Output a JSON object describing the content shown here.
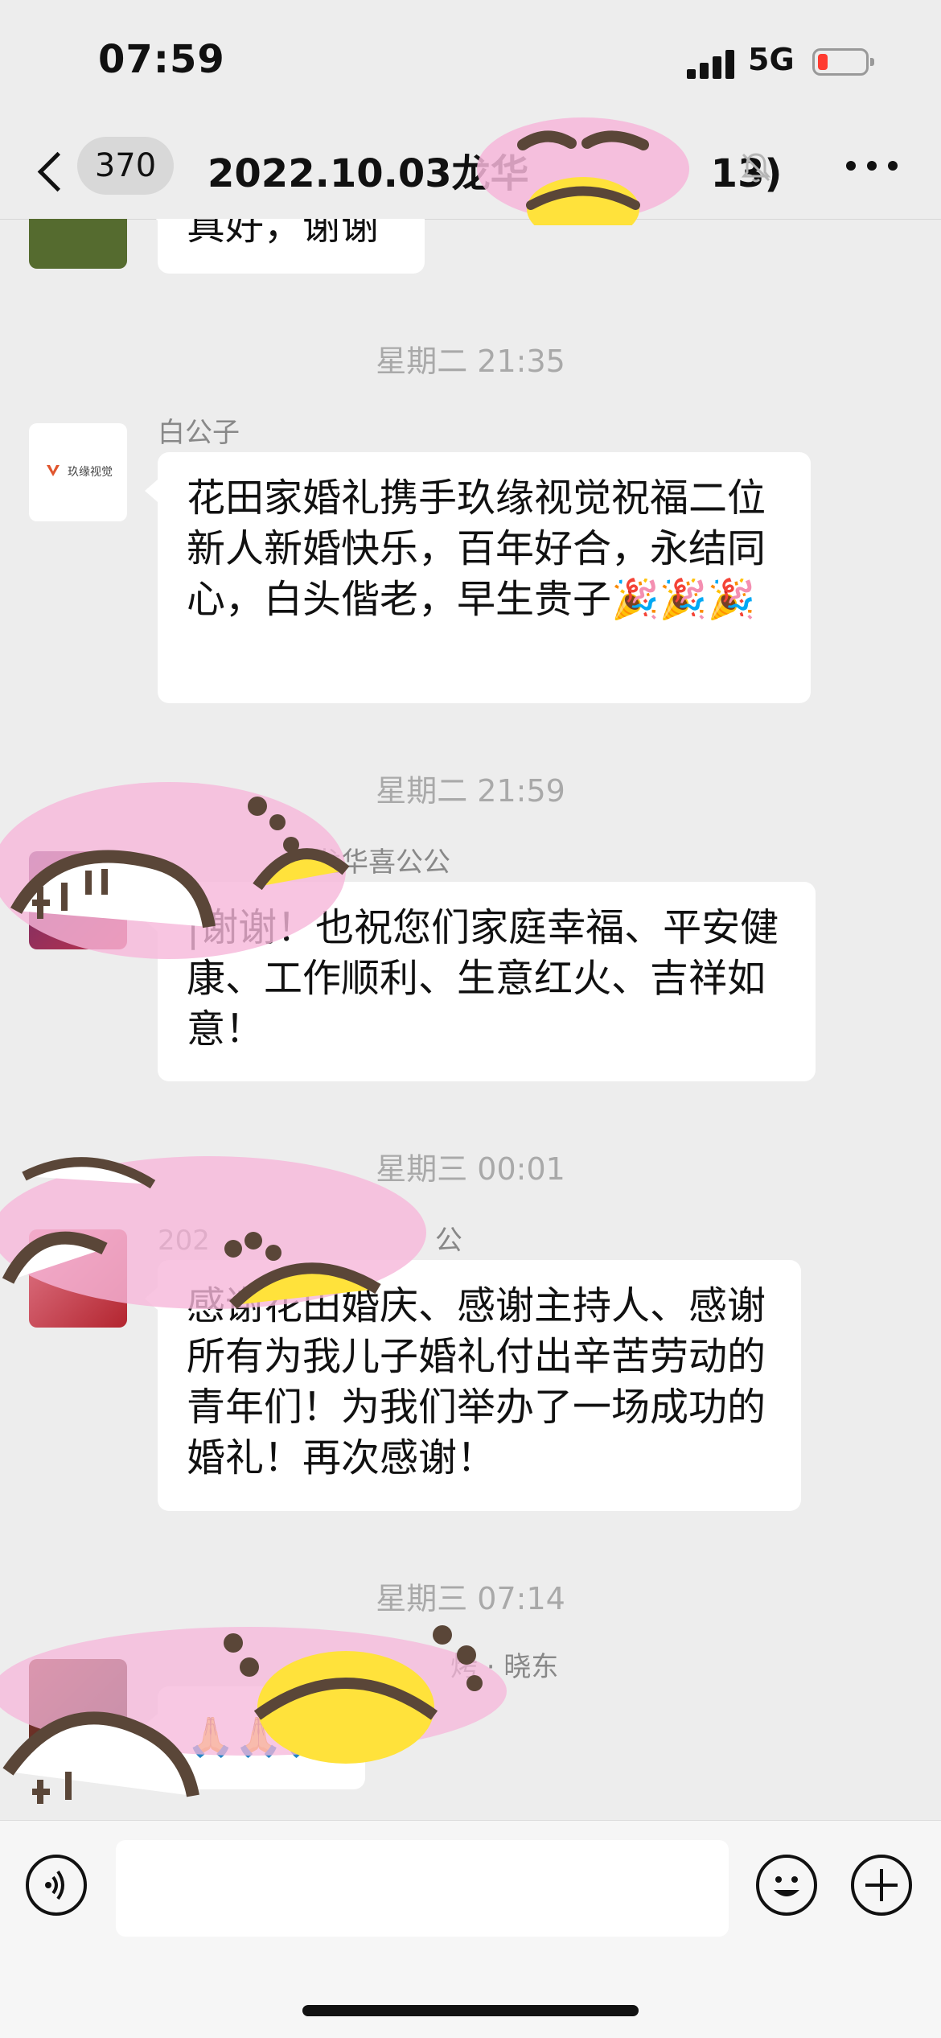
{
  "status_bar": {
    "time": "07:59",
    "network": "5G"
  },
  "nav": {
    "unread_count": "370",
    "title": "2022.10.03龙华",
    "title_suffix": "13)"
  },
  "messages": [
    {
      "text": "真好，谢谢"
    },
    {
      "timestamp": "星期二 21:35"
    },
    {
      "sender": "白公子",
      "avatar_text": "玖缘视觉",
      "text": "花田家婚礼携手玖缘视觉祝福二位新人新婚快乐，百年好合，永结同心，白头偕老，早生贵子🎉🎉🎉"
    },
    {
      "timestamp": "星期二 21:59"
    },
    {
      "sender": "龙华喜公公",
      "text": "|谢谢！也祝您们家庭幸福、平安健康、工作顺利、生意红火、吉祥如意！"
    },
    {
      "timestamp": "星期三 00:01"
    },
    {
      "sender_prefix": "202",
      "sender_suffix": "公",
      "text": "感谢花田婚庆、感谢主持人、感谢所有为我儿子婚礼付出辛苦劳动的青年们！为我们举办了一场成功的婚礼！再次感谢！"
    },
    {
      "timestamp": "星期三 07:14"
    },
    {
      "sender": "烤 · 晓东",
      "text": "🙏🙏🙏"
    }
  ],
  "icons": {
    "back": "chevron-left-icon",
    "mute": "bell-muted-icon",
    "more": "more-horizontal-icon",
    "voice": "voice-icon",
    "emoji": "emoji-icon",
    "add": "plus-icon"
  },
  "colors": {
    "background": "#ededed",
    "bubble": "#ffffff",
    "battery_low": "#ff3b30",
    "sticker_pink": "#f6b6d9"
  }
}
